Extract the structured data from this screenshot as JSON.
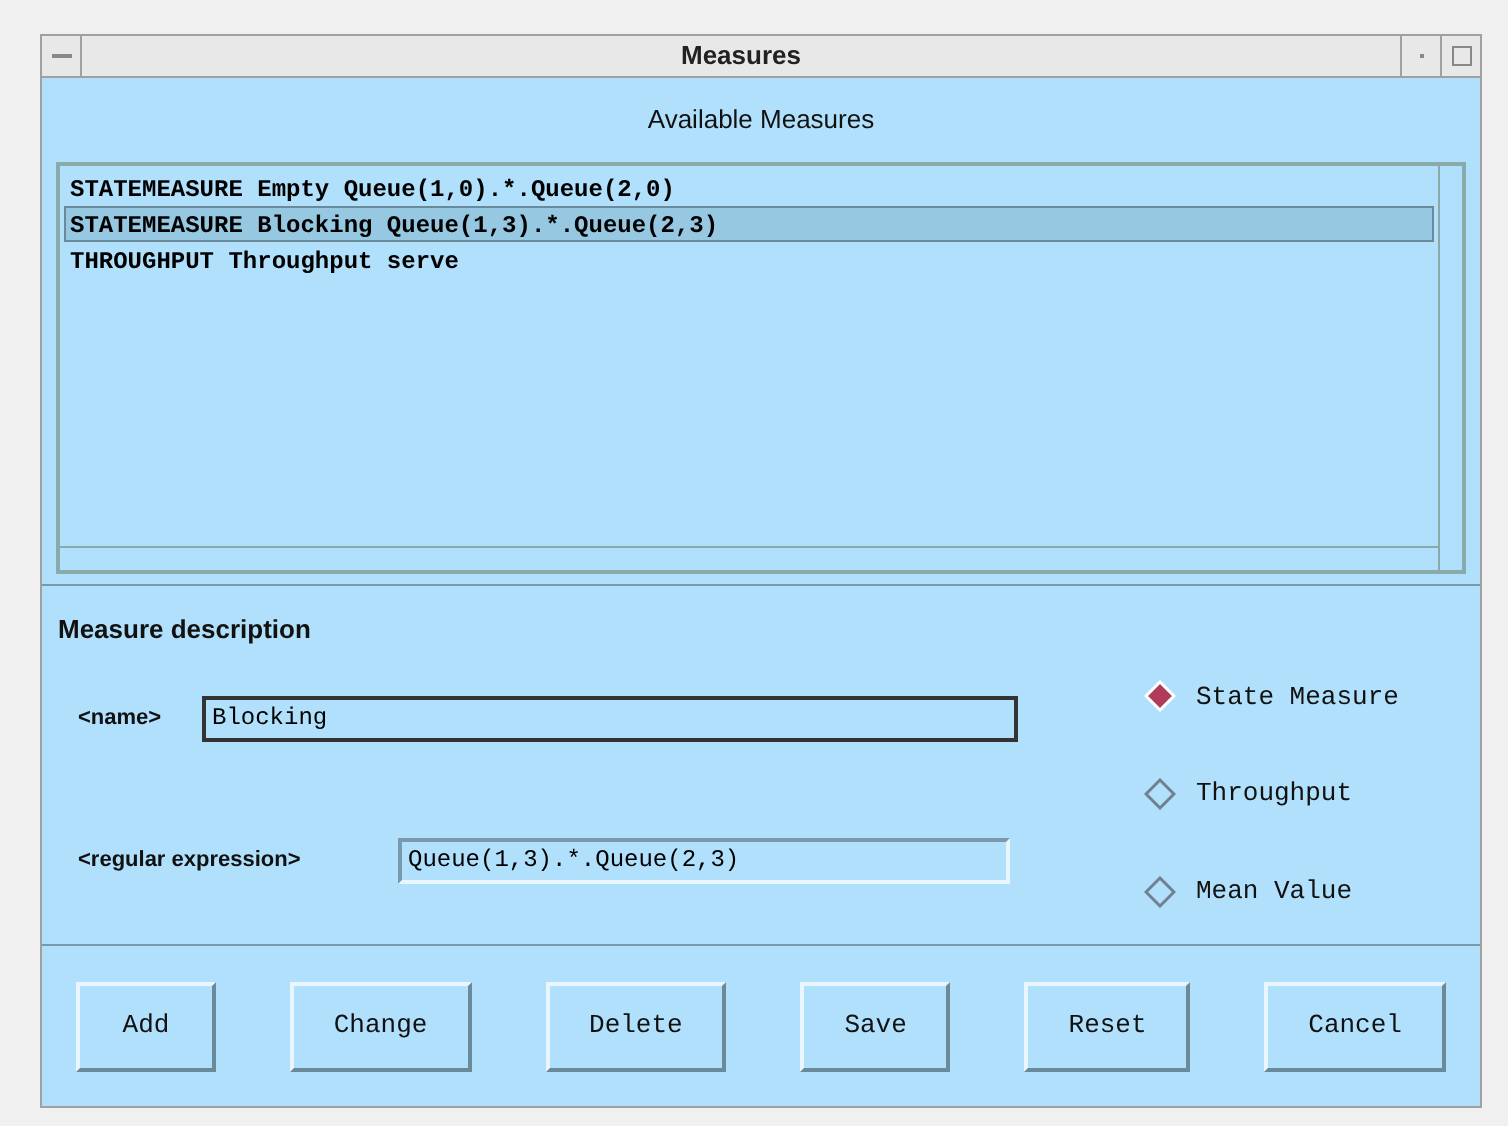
{
  "window": {
    "title": "Measures"
  },
  "list": {
    "heading": "Available Measures",
    "items": [
      {
        "text": "STATEMEASURE Empty Queue(1,0).*.Queue(2,0)",
        "selected": false
      },
      {
        "text": "STATEMEASURE Blocking Queue(1,3).*.Queue(2,3)",
        "selected": true
      },
      {
        "text": "THROUGHPUT Throughput serve",
        "selected": false
      }
    ]
  },
  "description": {
    "heading": "Measure description",
    "fields": [
      {
        "label": "<name>",
        "value": "Blocking"
      },
      {
        "label": "<regular expression>",
        "value": "Queue(1,3).*.Queue(2,3)"
      }
    ],
    "types": [
      {
        "label": "State Measure",
        "selected": true
      },
      {
        "label": "Throughput",
        "selected": false
      },
      {
        "label": "Mean Value",
        "selected": false
      }
    ]
  },
  "buttons": [
    "Add",
    "Change",
    "Delete",
    "Save",
    "Reset",
    "Cancel"
  ]
}
